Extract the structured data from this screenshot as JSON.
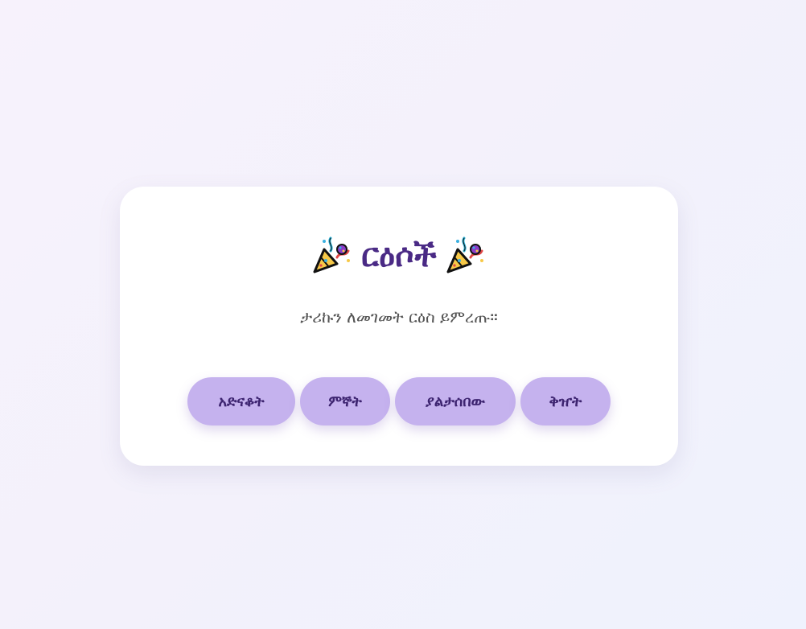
{
  "card": {
    "title": "ርዕሶች",
    "title_icon": "party-popper-icon",
    "subtitle": "ታሪኩን ለመገመት ርዕስ ይምረጡ።",
    "buttons": [
      {
        "label": "አድናቆት"
      },
      {
        "label": "ምኞት"
      },
      {
        "label": "ያልታሰበው"
      },
      {
        "label": "ቅዠት"
      }
    ]
  },
  "colors": {
    "title": "#4a2a85",
    "button_bg": "#c5b2ee",
    "button_text": "#3d2470",
    "card_bg": "#ffffff"
  }
}
